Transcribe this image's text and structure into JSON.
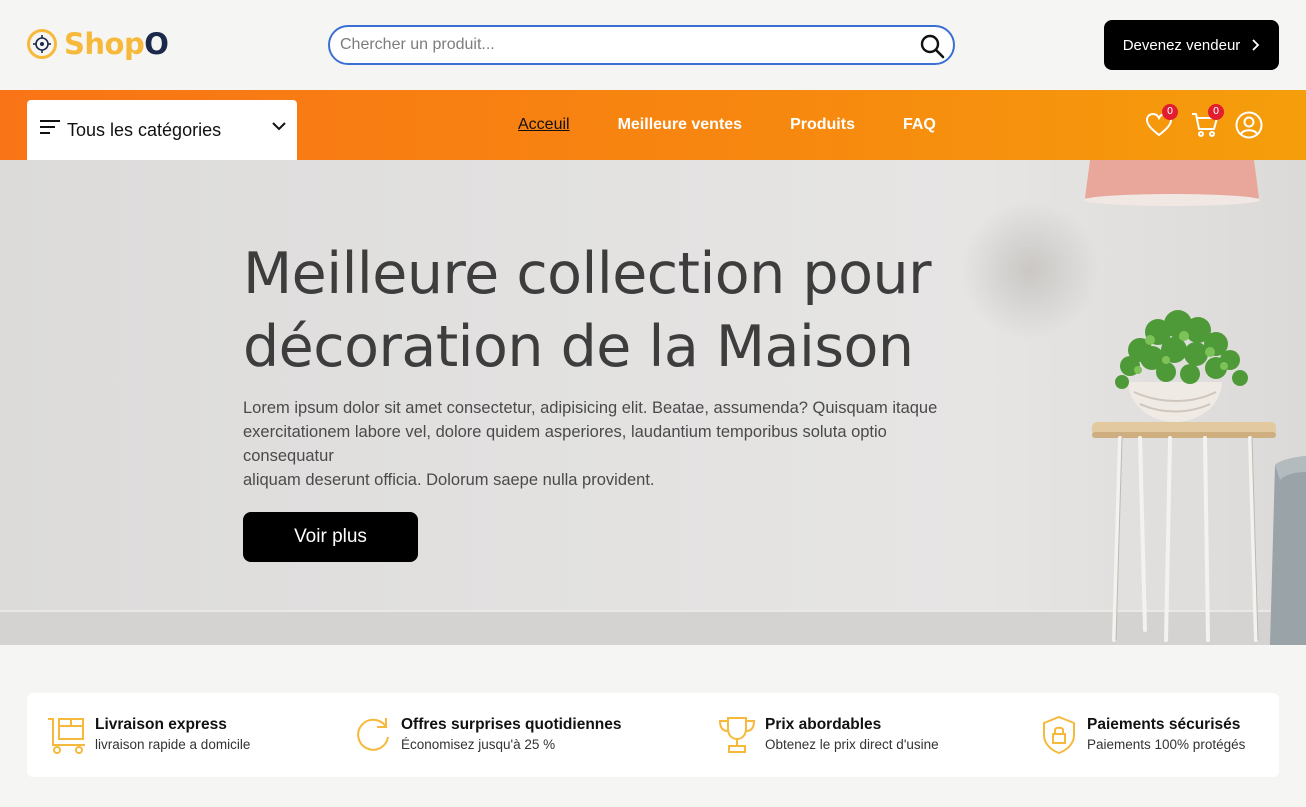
{
  "header": {
    "logo": {
      "part1": "Shop",
      "part2": "O",
      "icon": "logo-target-icon"
    },
    "search": {
      "placeholder": "Chercher un produit...",
      "value": "",
      "icon": "search-icon"
    },
    "seller_button": {
      "label": "Devenez vendeur",
      "icon": "chevron-right-icon"
    }
  },
  "nav": {
    "categories": {
      "label": "Tous les catégories",
      "icon": "menu-icon",
      "caret": "chevron-down-icon"
    },
    "links": [
      {
        "label": "Acceuil",
        "active": true
      },
      {
        "label": "Meilleure ventes",
        "active": false
      },
      {
        "label": "Produits",
        "active": false
      },
      {
        "label": "FAQ",
        "active": false
      }
    ],
    "wishlist": {
      "icon": "heart-icon",
      "count": "0"
    },
    "cart": {
      "icon": "cart-icon",
      "count": "0"
    },
    "account": {
      "icon": "user-icon"
    }
  },
  "hero": {
    "title_line1": "Meilleure collection pour",
    "title_line2": "décoration de la Maison",
    "desc_line1": "Lorem ipsum dolor sit amet consectetur, adipisicing elit. Beatae, assumenda? Quisquam itaque",
    "desc_line2": "exercitationem labore vel, dolore quidem asperiores, laudantium temporibus soluta optio",
    "desc_line3": "consequatur",
    "desc_line4": "aliquam deserunt officia. Dolorum saepe nulla provident.",
    "button": "Voir plus"
  },
  "features": [
    {
      "icon": "delivery-cart-icon",
      "title": "Livraison express",
      "subtitle": "livraison rapide a domicile"
    },
    {
      "icon": "refresh-icon",
      "title": "Offres surprises quotidiennes",
      "subtitle": "Économisez jusqu'à 25 %"
    },
    {
      "icon": "trophy-icon",
      "title": "Prix abordables",
      "subtitle": "Obtenez le prix direct d'usine"
    },
    {
      "icon": "shield-lock-icon",
      "title": "Paiements sécurisés",
      "subtitle": "Paiements 100% protégés"
    }
  ],
  "colors": {
    "accent_orange": "#f97416",
    "accent_yellow": "#f6b93b",
    "search_border": "#3b6fd4",
    "badge_red": "#e11d2f"
  }
}
